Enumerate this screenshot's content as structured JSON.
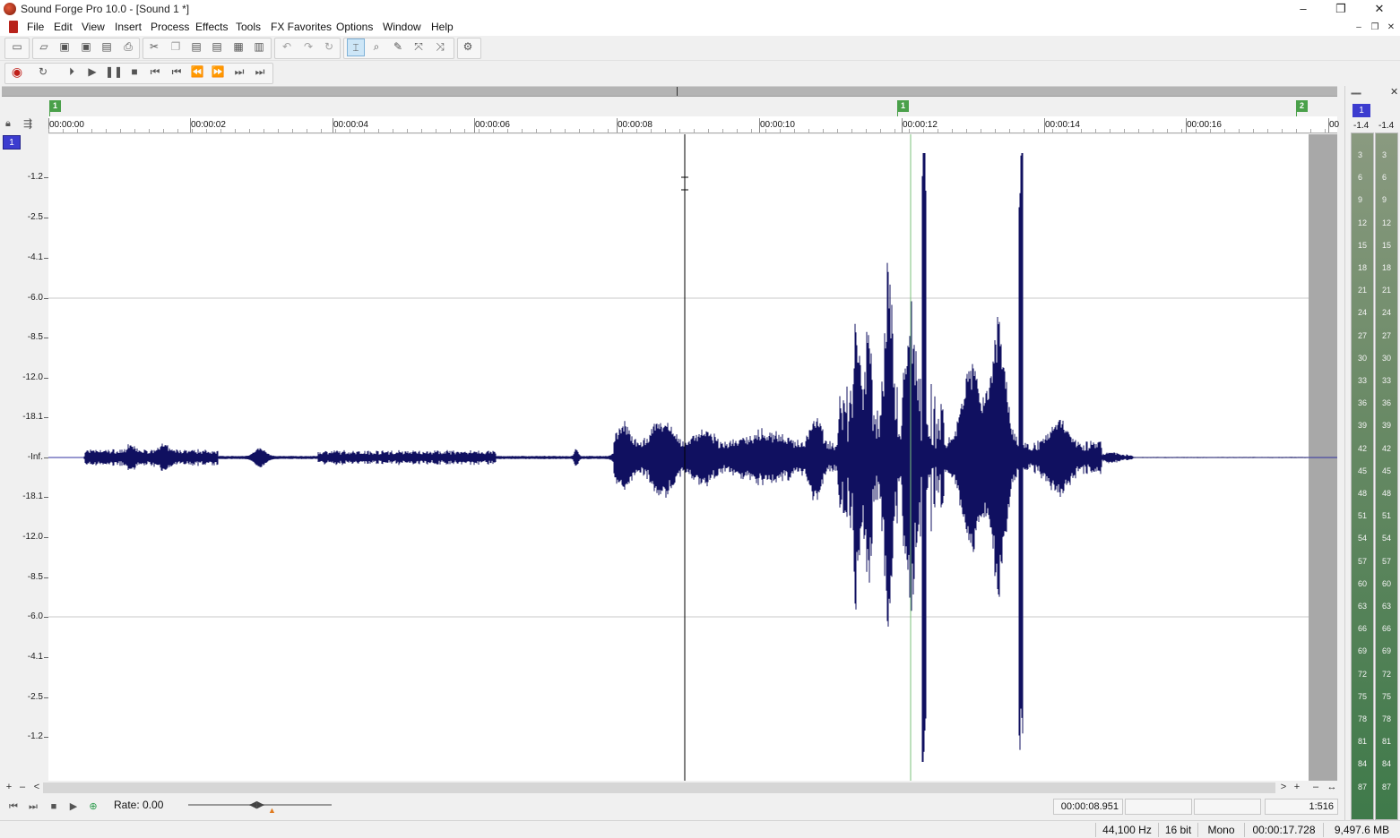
{
  "window": {
    "title": "Sound Forge Pro 10.0 - [Sound 1 *]",
    "minimize": "–",
    "restore": "❐",
    "close": "✕"
  },
  "menu": [
    "File",
    "Edit",
    "View",
    "Insert",
    "Process",
    "Effects",
    "Tools",
    "FX Favorites",
    "Options",
    "Window",
    "Help"
  ],
  "mdi": {
    "minimize": "–",
    "restore": "❐",
    "close": "✕"
  },
  "toolbar": {
    "file_icons": [
      "new-icon",
      "open-icon",
      "save-icon",
      "save-as-icon",
      "render-icon",
      "print-icon"
    ],
    "edit_icons": [
      "cut-icon",
      "copy-icon",
      "paste-icon",
      "paste-special-icon",
      "mix-icon",
      "crop-icon"
    ],
    "history_icons": [
      "undo-icon",
      "redo-icon",
      "repeat-icon"
    ],
    "tool_icons": [
      "edit-tool-icon",
      "magnify-tool-icon",
      "pencil-tool-icon",
      "envelope-tool-icon",
      "event-tool-icon"
    ],
    "extra_icons": [
      "plugin-chainer-icon"
    ]
  },
  "transport_toolbar": {
    "icons": [
      "record-icon",
      "loop-icon",
      "play-all-icon",
      "play-icon",
      "pause-icon",
      "stop-icon",
      "go-to-start-icon",
      "previous-icon",
      "rewind-icon",
      "fast-forward-icon",
      "next-icon",
      "go-to-end-icon"
    ]
  },
  "markers": [
    {
      "label": "1"
    },
    {
      "label": "1"
    },
    {
      "label": "2"
    }
  ],
  "ruler": {
    "labels": [
      "00:00:00",
      "00:00:02",
      "00:00:04",
      "00:00:06",
      "00:00:08",
      "00:00:10",
      "00:00:12",
      "00:00:14",
      "00:00:16",
      "00"
    ]
  },
  "channel": {
    "label": "1"
  },
  "db_scale": [
    "-1.2",
    "-2.5",
    "-4.1",
    "-6.0",
    "-8.5",
    "-12.0",
    "-18.1",
    "-Inf.",
    "-18.1",
    "-12.0",
    "-8.5",
    "-6.0",
    "-4.1",
    "-2.5",
    "-1.2"
  ],
  "colors": {
    "waveform": "#101060",
    "cursor": "#000000",
    "marker": "#4aa04a",
    "channel_badge": "#3c3ccf"
  },
  "scroll": {
    "zoom_in": "+",
    "zoom_out": "–",
    "left": "<",
    "right": ">",
    "vzoom_in": "+",
    "vzoom_out": "–",
    "fit": "↔"
  },
  "transport": {
    "rate_label": "Rate: 0.00",
    "cursor_time": "00:00:08.951",
    "field2": "",
    "field3": "",
    "zoom_ratio": "1:516"
  },
  "status": {
    "sample_rate": "44,100 Hz",
    "bit_depth": "16 bit",
    "channels": "Mono",
    "length": "00:00:17.728",
    "free_space": "9,497.6 MB"
  },
  "meters": {
    "grip": "▪▪▪▪▪▪",
    "close": "✕",
    "channel_label": "1",
    "peaks": [
      "-1.4",
      "-1.4"
    ],
    "scale": [
      "3",
      "6",
      "9",
      "12",
      "15",
      "18",
      "21",
      "24",
      "27",
      "30",
      "33",
      "36",
      "39",
      "42",
      "45",
      "48",
      "51",
      "54",
      "57",
      "60",
      "63",
      "66",
      "69",
      "72",
      "75",
      "78",
      "81",
      "84",
      "87"
    ]
  }
}
